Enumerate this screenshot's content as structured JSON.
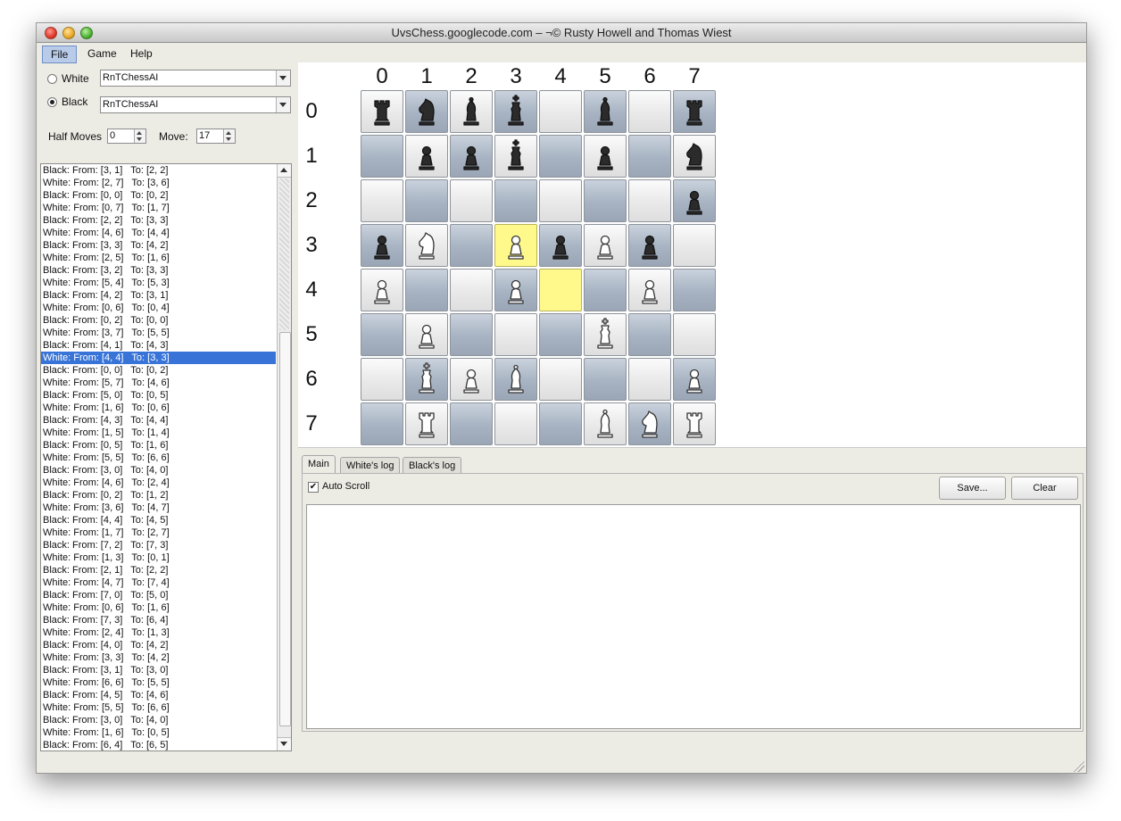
{
  "window": {
    "title": "UvsChess.googlecode.com – ¬© Rusty Howell and Thomas Wiest"
  },
  "menu": [
    "File",
    "Game",
    "Help"
  ],
  "players": {
    "white": {
      "label": "White",
      "ai": "RnTChessAI",
      "selected": false
    },
    "black": {
      "label": "Black",
      "ai": "RnTChessAI",
      "selected": true
    }
  },
  "counters": {
    "half_moves_label": "Half Moves",
    "half_moves_value": "0",
    "move_label": "Move:",
    "move_value": "17"
  },
  "moves": [
    "Black: From: [3, 1]   To: [2, 2]",
    "White: From: [2, 7]   To: [3, 6]",
    "Black: From: [0, 0]   To: [0, 2]",
    "White: From: [0, 7]   To: [1, 7]",
    "Black: From: [2, 2]   To: [3, 3]",
    "White: From: [4, 6]   To: [4, 4]",
    "Black: From: [3, 3]   To: [4, 2]",
    "White: From: [2, 5]   To: [1, 6]",
    "Black: From: [3, 2]   To: [3, 3]",
    "White: From: [5, 4]   To: [5, 3]",
    "Black: From: [4, 2]   To: [3, 1]",
    "White: From: [0, 6]   To: [0, 4]",
    "Black: From: [0, 2]   To: [0, 0]",
    "White: From: [3, 7]   To: [5, 5]",
    "Black: From: [4, 1]   To: [4, 3]",
    "White: From: [4, 4]   To: [3, 3]",
    "Black: From: [0, 0]   To: [0, 2]",
    "White: From: [5, 7]   To: [4, 6]",
    "Black: From: [5, 0]   To: [0, 5]",
    "White: From: [1, 6]   To: [0, 6]",
    "Black: From: [4, 3]   To: [4, 4]",
    "White: From: [1, 5]   To: [1, 4]",
    "Black: From: [0, 5]   To: [1, 6]",
    "White: From: [5, 5]   To: [6, 6]",
    "Black: From: [3, 0]   To: [4, 0]",
    "White: From: [4, 6]   To: [2, 4]",
    "Black: From: [0, 2]   To: [1, 2]",
    "White: From: [3, 6]   To: [4, 7]",
    "Black: From: [4, 4]   To: [4, 5]",
    "White: From: [1, 7]   To: [2, 7]",
    "Black: From: [7, 2]   To: [7, 3]",
    "White: From: [1, 3]   To: [0, 1]",
    "Black: From: [2, 1]   To: [2, 2]",
    "White: From: [4, 7]   To: [7, 4]",
    "Black: From: [7, 0]   To: [5, 0]",
    "White: From: [0, 6]   To: [1, 6]",
    "Black: From: [7, 3]   To: [6, 4]",
    "White: From: [2, 4]   To: [1, 3]",
    "Black: From: [4, 0]   To: [4, 2]",
    "White: From: [3, 3]   To: [4, 2]",
    "Black: From: [3, 1]   To: [3, 0]",
    "White: From: [6, 6]   To: [5, 5]",
    "Black: From: [4, 5]   To: [4, 6]",
    "White: From: [5, 5]   To: [6, 6]",
    "Black: From: [3, 0]   To: [4, 0]",
    "White: From: [1, 6]   To: [0, 5]",
    "Black: From: [6, 4]   To: [6, 5]"
  ],
  "selected_move_index": 15,
  "board": {
    "col_labels": [
      "0",
      "1",
      "2",
      "3",
      "4",
      "5",
      "6",
      "7"
    ],
    "row_labels": [
      "0",
      "1",
      "2",
      "3",
      "4",
      "5",
      "6",
      "7"
    ],
    "pieces": [
      [
        "bR",
        "bN",
        "bB",
        "bK",
        "",
        "bB",
        "",
        "bR"
      ],
      [
        "",
        "bP",
        "bP",
        "bK",
        "",
        "bP",
        "",
        "bN"
      ],
      [
        "",
        "",
        "",
        "",
        "",
        "",
        "",
        "bP"
      ],
      [
        "bP",
        "wN",
        "",
        "wP",
        "bP",
        "wP",
        "bP",
        ""
      ],
      [
        "wP",
        "",
        "",
        "wP",
        "",
        "",
        "wP",
        ""
      ],
      [
        "",
        "wP",
        "",
        "",
        "",
        "wK",
        "",
        ""
      ],
      [
        "",
        "wK",
        "wP",
        "wB",
        "",
        "",
        "",
        "wP"
      ],
      [
        "",
        "wR",
        "",
        "",
        "",
        "wB",
        "wN",
        "wR"
      ]
    ],
    "highlighted": [
      [
        3,
        3
      ],
      [
        4,
        4
      ]
    ],
    "light_color": "#f0f0f0",
    "dark_color": "#a9b5c4",
    "highlight_color": "#fff98c"
  },
  "tabs": [
    "Main",
    "White's log",
    "Black's log"
  ],
  "log": {
    "auto_scroll_label": "Auto Scroll",
    "auto_scroll_checked": true,
    "save_label": "Save...",
    "clear_label": "Clear"
  }
}
